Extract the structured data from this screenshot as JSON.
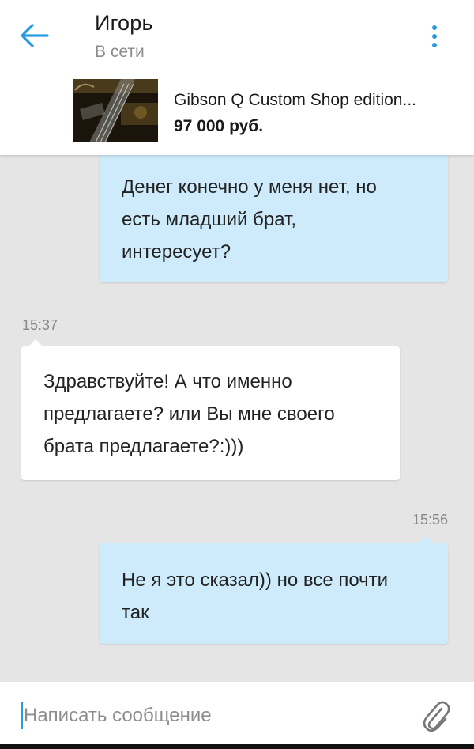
{
  "header": {
    "contact_name": "Игорь",
    "contact_status": "В сети",
    "back_icon": "arrow-left-icon",
    "more_icon": "more-vertical-icon",
    "accent_color": "#2a9be0"
  },
  "listing": {
    "title": "Gibson Q Custom Shop edition...",
    "price": "97 000 руб."
  },
  "messages": [
    {
      "direction": "outgoing",
      "lines": [
        "Денег конечно у меня нет, но",
        "есть младший брат,",
        "интересует?"
      ]
    },
    {
      "direction": "incoming",
      "time": "15:37",
      "lines": [
        "Здравствуйте! А что именно",
        "предлагаете? или Вы мне своего",
        "брата предлагаете?:)))"
      ]
    },
    {
      "direction": "outgoing",
      "time": "15:56",
      "lines": [
        "Не я это сказал)) но все почти",
        "так"
      ]
    }
  ],
  "composer": {
    "placeholder": "Написать сообщение",
    "attach_icon": "paperclip-icon"
  },
  "colors": {
    "outgoing_bubble": "#cdebfb",
    "incoming_bubble": "#ffffff",
    "chat_background": "#e5e5e5"
  }
}
